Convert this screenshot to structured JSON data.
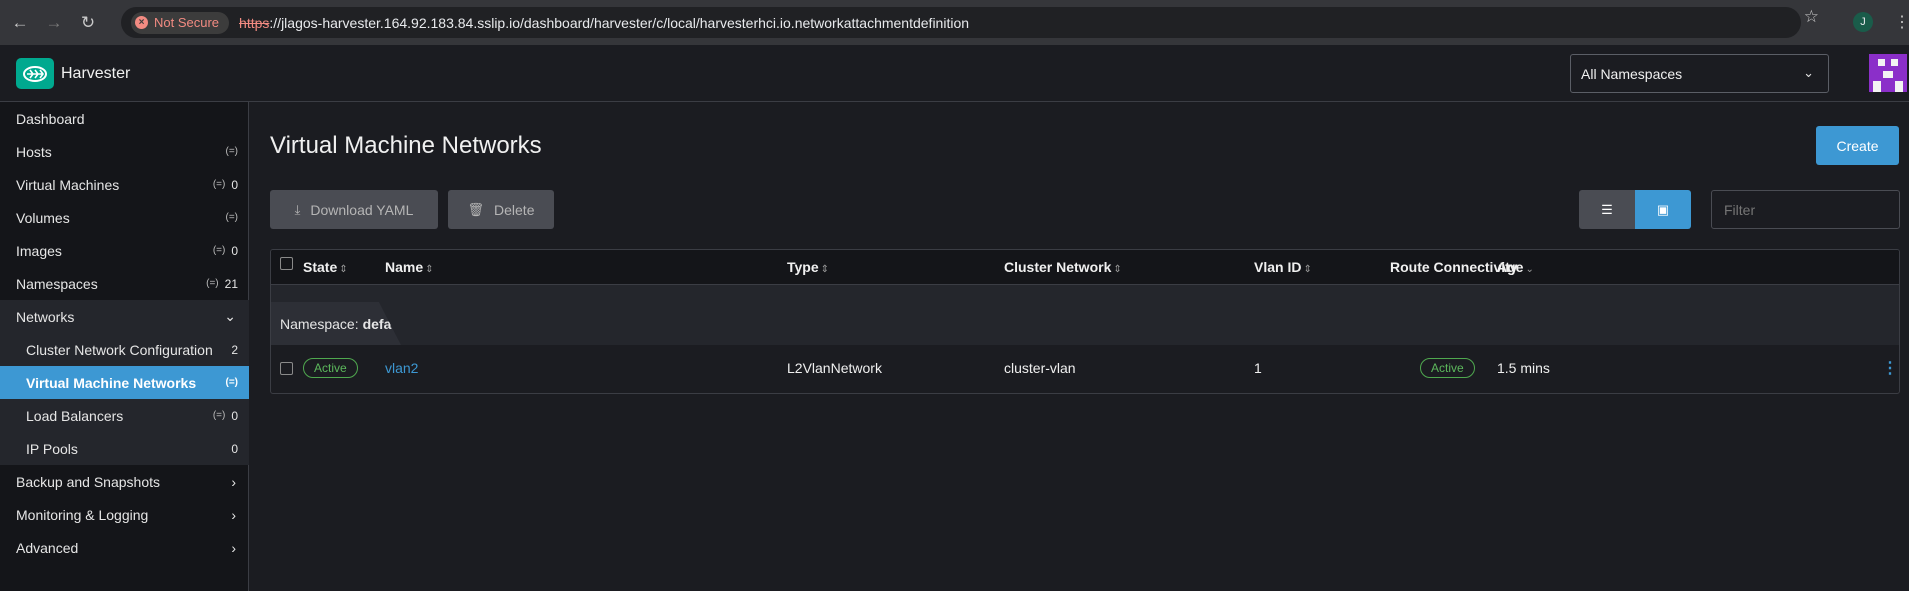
{
  "browser": {
    "security_label": "Not Secure",
    "url_scheme": "https",
    "url_rest": "://jlagos-harvester.164.92.183.84.sslip.io/dashboard/harvester/c/local/harvesterhci.io.networkattachmentdefinition",
    "profile_initial": "J"
  },
  "header": {
    "brand": "Harvester",
    "namespace_select": "All Namespaces"
  },
  "sidebar": {
    "items": [
      {
        "label": "Dashboard",
        "count": "",
        "ns": false
      },
      {
        "label": "Hosts",
        "count": "",
        "ns": true
      },
      {
        "label": "Virtual Machines",
        "count": "0",
        "ns": true
      },
      {
        "label": "Volumes",
        "count": "",
        "ns": true
      },
      {
        "label": "Images",
        "count": "0",
        "ns": true
      },
      {
        "label": "Namespaces",
        "count": "21",
        "ns": true
      },
      {
        "label": "Networks",
        "count": "",
        "ns": false
      },
      {
        "label": "Cluster Network Configuration",
        "count": "2",
        "ns": false
      },
      {
        "label": "Virtual Machine Networks",
        "count": "",
        "ns": true
      },
      {
        "label": "Load Balancers",
        "count": "0",
        "ns": true
      },
      {
        "label": "IP Pools",
        "count": "0",
        "ns": false
      },
      {
        "label": "Backup and Snapshots",
        "count": "",
        "ns": false
      },
      {
        "label": "Monitoring & Logging",
        "count": "",
        "ns": false
      },
      {
        "label": "Advanced",
        "count": "",
        "ns": false
      }
    ],
    "ns_glyph": "(=)"
  },
  "main": {
    "title": "Virtual Machine Networks",
    "create_label": "Create",
    "download_label": "Download YAML",
    "delete_label": "Delete",
    "filter_placeholder": "Filter"
  },
  "table": {
    "columns": [
      "State",
      "Name",
      "Type",
      "Cluster Network",
      "Vlan ID",
      "Route Connectivity",
      "Age"
    ],
    "group_prefix": "Namespace:",
    "group_name": "default",
    "rows": [
      {
        "state": "Active",
        "name": "vlan2",
        "type": "L2VlanNetwork",
        "cluster_network": "cluster-vlan",
        "vlan_id": "1",
        "route_connectivity": "Active",
        "age": "1.5 mins"
      }
    ]
  },
  "colors": {
    "accent": "#3d98d3",
    "brand": "#00a98f",
    "status_active": "#5cb85c"
  }
}
